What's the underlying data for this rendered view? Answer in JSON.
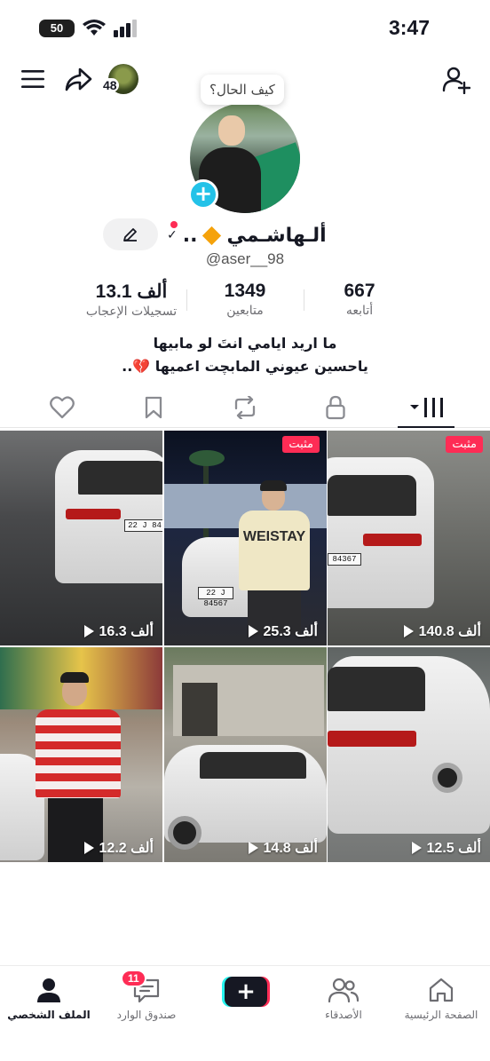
{
  "status_bar": {
    "time": "3:47",
    "battery": "50"
  },
  "top_nav": {
    "friends_count": "48"
  },
  "profile": {
    "bubble_text": "كيف الحال؟",
    "display_name": "ألـهاشـمي",
    "name_suffix": "..",
    "username": "@aser__98"
  },
  "stats": [
    {
      "value": "667",
      "label": "أتابعه"
    },
    {
      "value": "1349",
      "label": "متابعين"
    },
    {
      "value": "13.1 ألف",
      "label": "تسجيلات الإعجاب"
    }
  ],
  "bio": {
    "line1": "ما اريد ايامي انتَ لو مابيها",
    "line2": "ياحسين عيوني المابچت اعميها 💔.."
  },
  "tabs": [
    "videos",
    "private",
    "reposts",
    "favorites",
    "liked"
  ],
  "videos": [
    {
      "views": "16.3 ألف",
      "pinned": false
    },
    {
      "views": "25.3 ألف",
      "pinned": true,
      "pin_label": "مثبت"
    },
    {
      "views": "140.8 ألف",
      "pinned": true,
      "pin_label": "مثبت"
    },
    {
      "views": "12.2 ألف",
      "pinned": false
    },
    {
      "views": "14.8 ألف",
      "pinned": false
    },
    {
      "views": "12.5 ألف",
      "pinned": false
    }
  ],
  "bottom_nav": {
    "home": "الصفحة الرئيسية",
    "friends": "الأصدقاء",
    "inbox": "صندوق الوارد",
    "inbox_badge": "11",
    "profile": "الملف الشخصي"
  },
  "colors": {
    "accent": "#fe2c55",
    "cyan": "#25f4ee",
    "text": "#161823"
  }
}
